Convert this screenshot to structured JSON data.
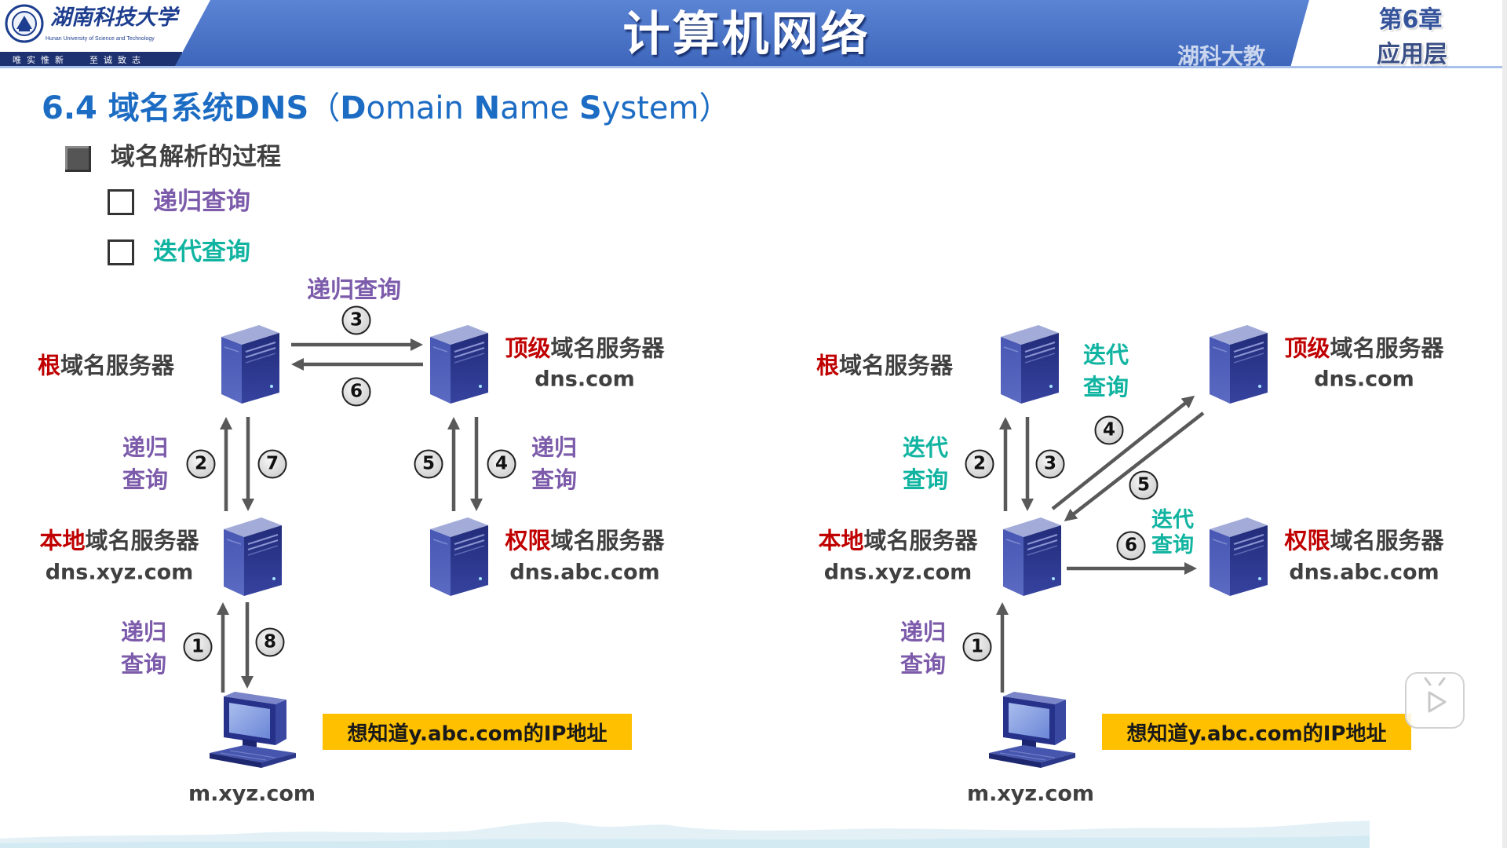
{
  "header": {
    "university_name": "湖南科技大学",
    "university_name_en": "Hunan University of Science and Technology",
    "motto_left": "唯实惟新",
    "motto_right": "至诚致志",
    "course_title": "计算机网络",
    "chapter": "第6章",
    "chapter_name": "应用层",
    "watermark": "湖科大教"
  },
  "slide": {
    "title_parts": [
      "6.4 域名系统DNS",
      "（",
      "D",
      "omain ",
      "N",
      "ame ",
      "S",
      "ystem",
      "）"
    ],
    "bullet": "域名解析的过程",
    "sub_bullets": [
      "递归查询",
      "迭代查询"
    ]
  },
  "labels": {
    "recursive": [
      "递归",
      "查询"
    ],
    "iterative": [
      "迭代",
      "查询"
    ]
  },
  "servers": {
    "root": {
      "highlight": "根",
      "rest": "域名服务器"
    },
    "tld": {
      "highlight": "顶级",
      "rest": "域名服务器",
      "domain": "dns.com"
    },
    "local": {
      "highlight": "本地",
      "rest": "域名服务器",
      "domain": "dns.xyz.com"
    },
    "authoritative": {
      "highlight": "权限",
      "rest": "域名服务器",
      "domain": "dns.abc.com"
    }
  },
  "host": "m.xyz.com",
  "question": "想知道y.abc.com的IP地址",
  "left_diagram": {
    "steps": [
      "1",
      "2",
      "3",
      "4",
      "5",
      "6",
      "7",
      "8"
    ]
  },
  "right_diagram": {
    "steps": [
      "1",
      "2",
      "3",
      "4",
      "5",
      "6"
    ]
  },
  "icons": {
    "server": "server-icon",
    "host": "computer-icon",
    "logo": "university-emblem-icon",
    "play": "play-icon"
  },
  "colors": {
    "header_blue": "#4a72c6",
    "title_blue": "#1c6cc4",
    "highlight_red": "#c00000",
    "recursive_purple": "#7c5bab",
    "iterative_teal": "#11b4a1",
    "question_bg": "#ffc000",
    "arrow_gray": "#595959",
    "server_navy": "#26318a"
  }
}
